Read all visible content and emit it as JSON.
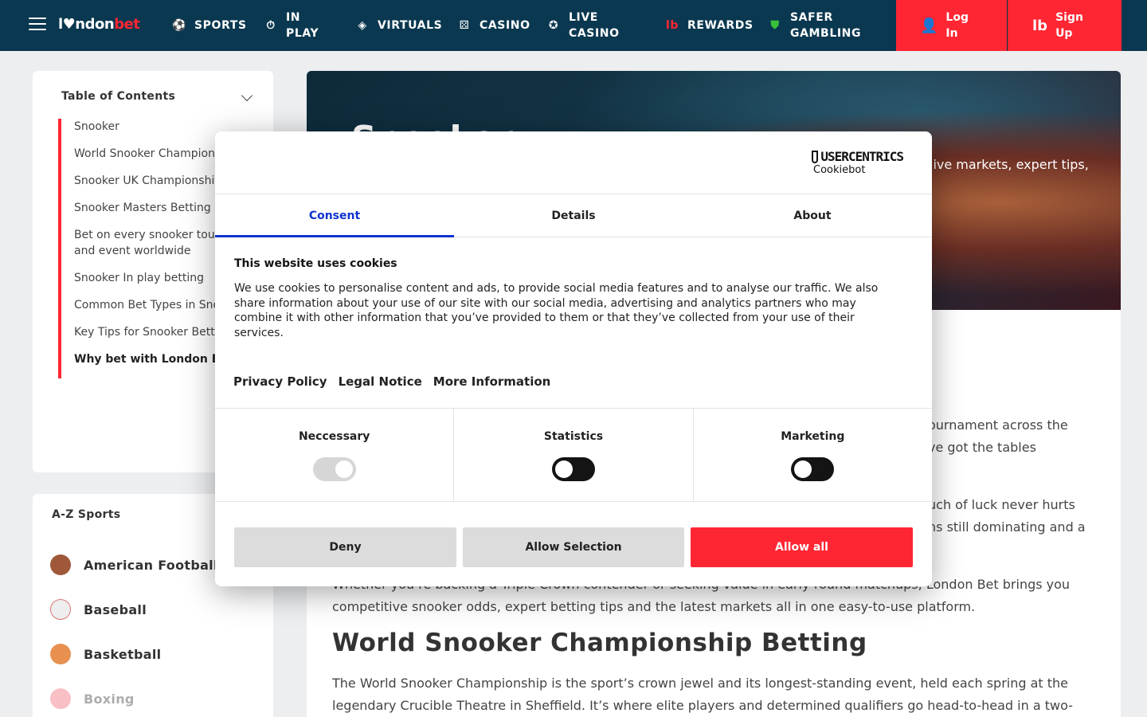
{
  "header": {
    "logo_a": "l♥ndon",
    "logo_b": "bet",
    "nav": [
      {
        "icon": "soccer-ball-icon",
        "label": "SPORTS"
      },
      {
        "icon": "stopwatch-icon",
        "label": "IN PLAY"
      },
      {
        "icon": "cube-icon",
        "label": "VIRTUALS"
      },
      {
        "icon": "dice-icon",
        "label": "CASINO"
      },
      {
        "icon": "live-chip-icon",
        "label": "LIVE CASINO"
      },
      {
        "icon": "lb-icon",
        "label": "REWARDS"
      },
      {
        "icon": "shield-check-icon",
        "label": "SAFER GAMBLING"
      }
    ],
    "login_label": "Log In",
    "signup_label": "Sign Up"
  },
  "toc": {
    "title": "Table of Contents",
    "items": [
      "Snooker",
      "World Snooker Champion Betting",
      "Snooker UK Championshi Betting",
      "Snooker Masters Betting",
      "Bet on every snooker tournament and event worldwide",
      "Snooker In play betting",
      "Common Bet Types in Sno Betting",
      "Key Tips for Snooker Bett",
      "Why bet with London B"
    ]
  },
  "az": {
    "title": "A-Z Sports",
    "sports": [
      "American Football",
      "Baseball",
      "Basketball",
      "Boxing"
    ]
  },
  "hero": {
    "title": "Snooker",
    "desc": "live markets, expert tips,"
  },
  "content": {
    "p1a": "ournament across the",
    "p1b": "ve got the tables",
    "p2a": "uch of luck never hurts",
    "p2b": "ns still dominating and a",
    "p3a": "Whether you’re backing a Triple Crown contender or seeking value in early-round matchups, London Bet brings you",
    "p3b": "competitive snooker odds, expert betting tips and the latest markets all in one easy-to-use platform.",
    "h2": "World Snooker Championship Betting",
    "p4a": "The World Snooker Championship is the sport’s crown jewel and its longest-standing event, held each spring at the",
    "p4b": "legendary Crucible Theatre in Sheffield. It’s where elite players and determined qualifiers go head-to-head in a two-"
  },
  "dialog": {
    "brand_1": "USERCENTRICS",
    "brand_2": "Cookiebot",
    "tabs": [
      "Consent",
      "Details",
      "About"
    ],
    "heading": "This website uses cookies",
    "body": "We use cookies to personalise content and ads, to provide social media features and to analyse our traffic. We also share information about your use of our site with our social media, advertising and analytics partners who may combine it with other information that you’ve provided to them or that they’ve collected from your use of their services.",
    "links": [
      "Privacy Policy",
      "Legal Notice",
      "More Information"
    ],
    "toggles": [
      {
        "label": "Neccessary",
        "state": "on-disabled"
      },
      {
        "label": "Statistics",
        "state": "off"
      },
      {
        "label": "Marketing",
        "state": "off"
      }
    ],
    "deny": "Deny",
    "allow_selection": "Allow Selection",
    "allow_all": "Allow all"
  },
  "colors": {
    "brand_red": "#ff2633",
    "header_bg": "#0a3850",
    "tab_blue": "#1032cf"
  }
}
